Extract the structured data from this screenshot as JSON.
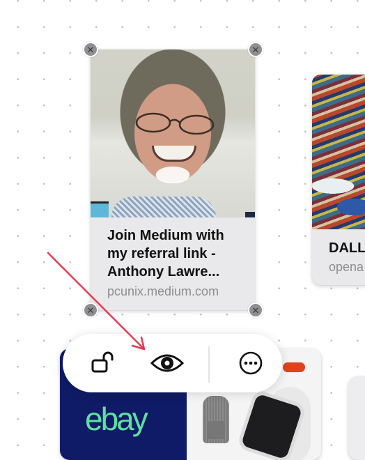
{
  "cards": [
    {
      "title": "Join Medium with my referral link - Anthony Lawre...",
      "domain": "pcunix.medium.com",
      "image": "portrait-photo"
    },
    {
      "title": "DALL",
      "domain": "opena",
      "image": "abstract-painting"
    },
    {
      "logo": "ebay",
      "image": "product-collage"
    }
  ],
  "toolbar": {
    "buttons": [
      {
        "name": "lock-button",
        "icon": "unlock-icon"
      },
      {
        "name": "preview-button",
        "icon": "eye-icon"
      },
      {
        "name": "more-button",
        "icon": "ellipsis-circle-icon"
      }
    ]
  },
  "annotation": {
    "type": "arrow",
    "color": "#e8384f"
  },
  "close_glyph": "✕"
}
